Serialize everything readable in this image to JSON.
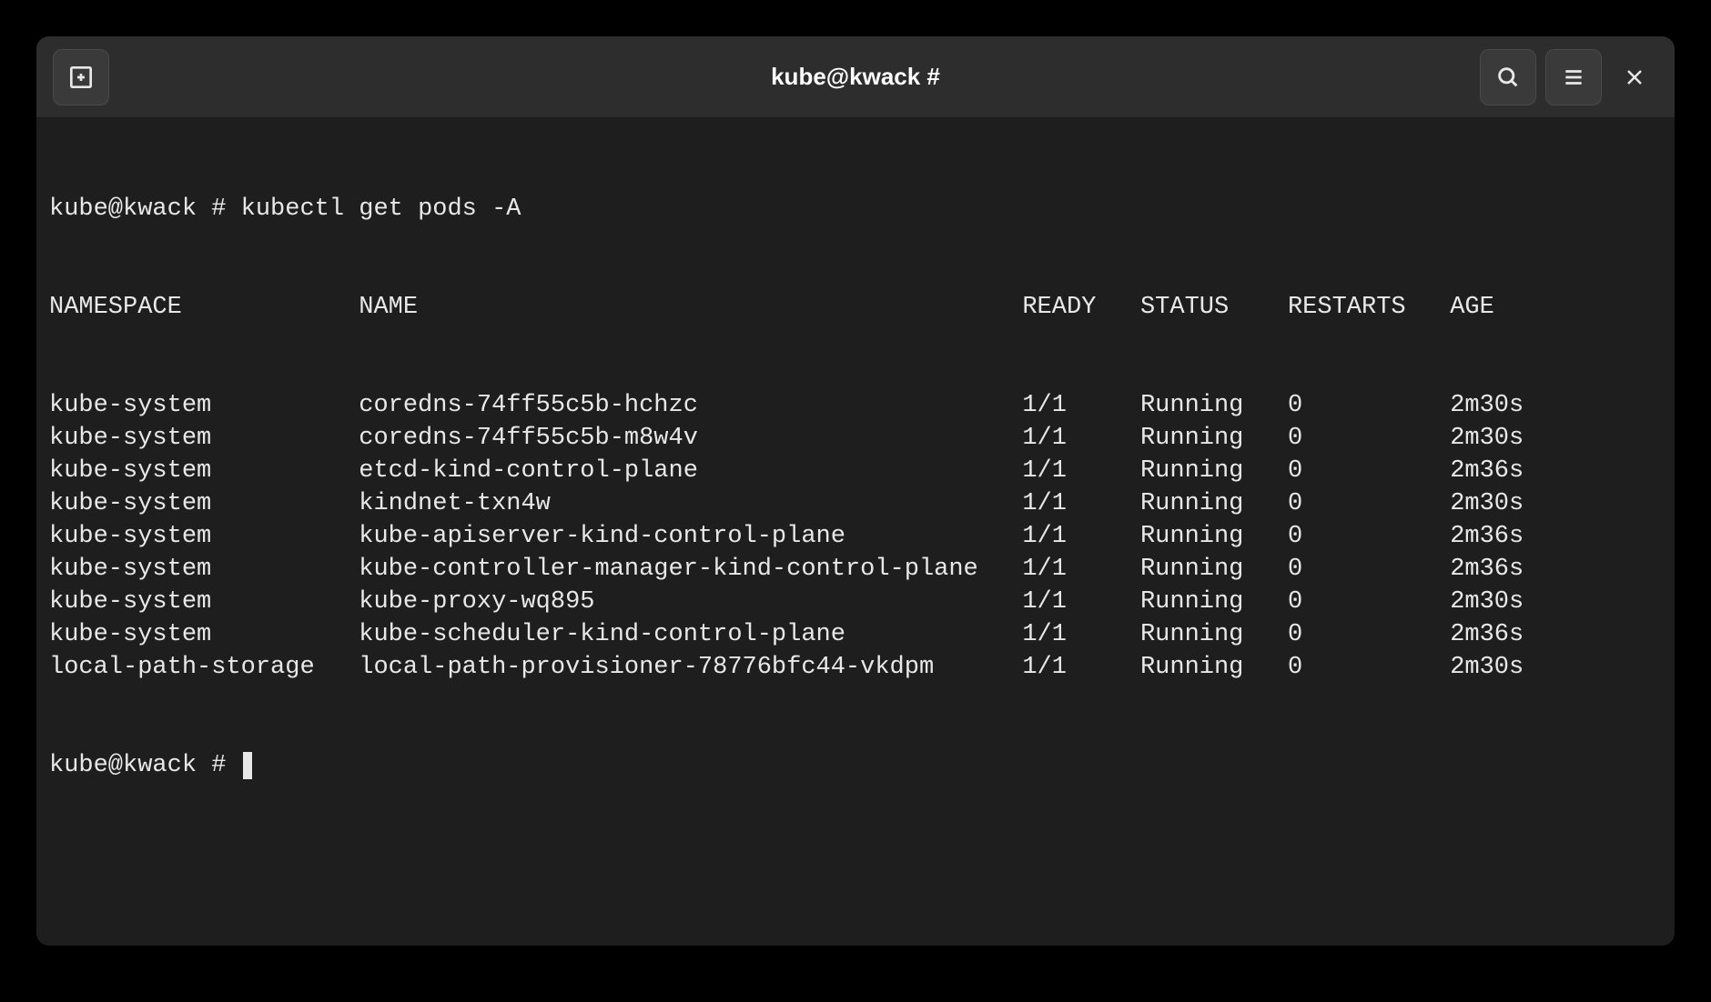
{
  "window": {
    "title": "kube@kwack #"
  },
  "terminal": {
    "prompt1": "kube@kwack # ",
    "command": "kubectl get pods -A",
    "prompt2": "kube@kwack # ",
    "headers": {
      "namespace": "NAMESPACE",
      "name": "NAME",
      "ready": "READY",
      "status": "STATUS",
      "restarts": "RESTARTS",
      "age": "AGE"
    },
    "rows": [
      {
        "namespace": "kube-system",
        "name": "coredns-74ff55c5b-hchzc",
        "ready": "1/1",
        "status": "Running",
        "restarts": "0",
        "age": "2m30s"
      },
      {
        "namespace": "kube-system",
        "name": "coredns-74ff55c5b-m8w4v",
        "ready": "1/1",
        "status": "Running",
        "restarts": "0",
        "age": "2m30s"
      },
      {
        "namespace": "kube-system",
        "name": "etcd-kind-control-plane",
        "ready": "1/1",
        "status": "Running",
        "restarts": "0",
        "age": "2m36s"
      },
      {
        "namespace": "kube-system",
        "name": "kindnet-txn4w",
        "ready": "1/1",
        "status": "Running",
        "restarts": "0",
        "age": "2m30s"
      },
      {
        "namespace": "kube-system",
        "name": "kube-apiserver-kind-control-plane",
        "ready": "1/1",
        "status": "Running",
        "restarts": "0",
        "age": "2m36s"
      },
      {
        "namespace": "kube-system",
        "name": "kube-controller-manager-kind-control-plane",
        "ready": "1/1",
        "status": "Running",
        "restarts": "0",
        "age": "2m36s"
      },
      {
        "namespace": "kube-system",
        "name": "kube-proxy-wq895",
        "ready": "1/1",
        "status": "Running",
        "restarts": "0",
        "age": "2m30s"
      },
      {
        "namespace": "kube-system",
        "name": "kube-scheduler-kind-control-plane",
        "ready": "1/1",
        "status": "Running",
        "restarts": "0",
        "age": "2m36s"
      },
      {
        "namespace": "local-path-storage",
        "name": "local-path-provisioner-78776bfc44-vkdpm",
        "ready": "1/1",
        "status": "Running",
        "restarts": "0",
        "age": "2m30s"
      }
    ]
  }
}
